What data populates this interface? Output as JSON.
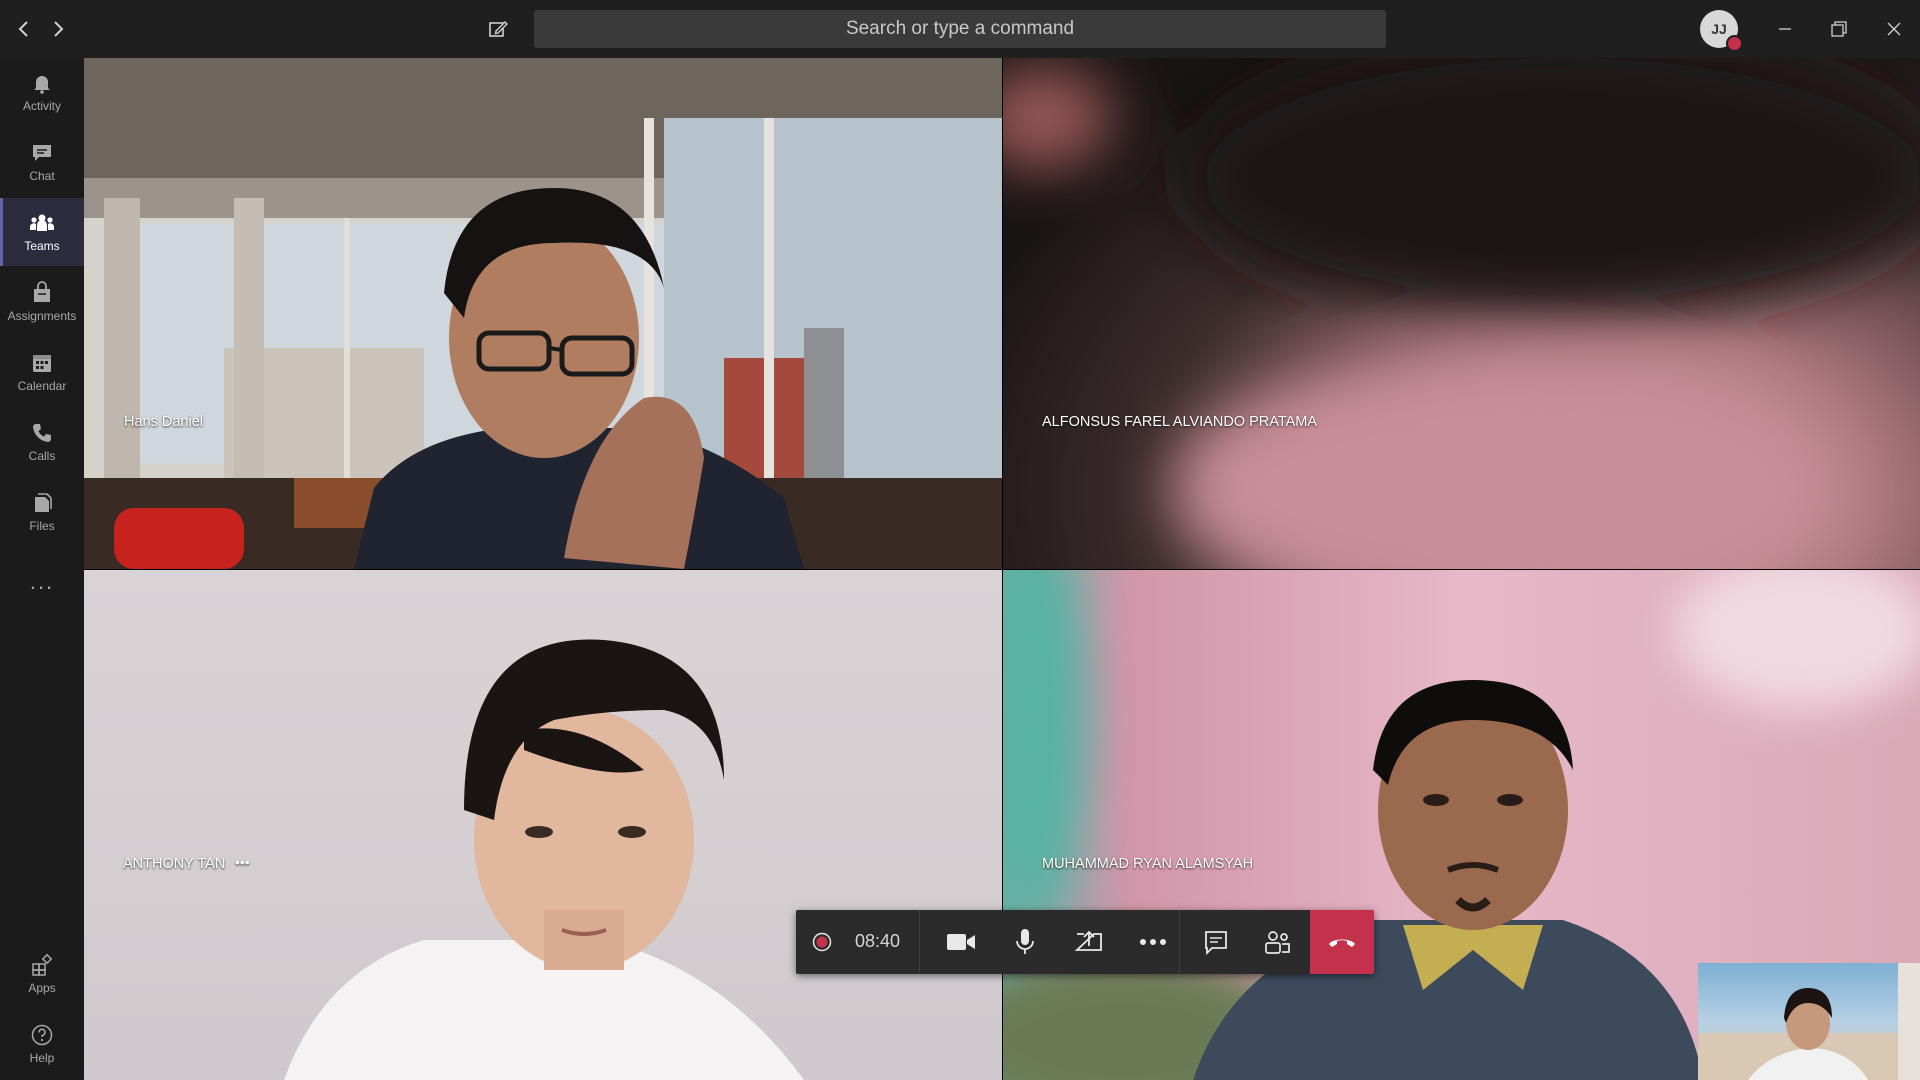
{
  "titlebar": {
    "search_placeholder": "Search or type a command",
    "avatar_initials": "JJ",
    "presence_color": "#c4314b"
  },
  "rail": {
    "items": [
      {
        "label": "Activity",
        "icon": "bell-icon"
      },
      {
        "label": "Chat",
        "icon": "chat-icon"
      },
      {
        "label": "Teams",
        "icon": "teams-icon",
        "active": true
      },
      {
        "label": "Assignments",
        "icon": "assignments-icon"
      },
      {
        "label": "Calendar",
        "icon": "calendar-icon"
      },
      {
        "label": "Calls",
        "icon": "phone-icon"
      },
      {
        "label": "Files",
        "icon": "files-icon"
      },
      {
        "label": "...",
        "icon": "more-icon"
      }
    ],
    "bottom": [
      {
        "label": "Apps",
        "icon": "apps-icon"
      },
      {
        "label": "Help",
        "icon": "help-icon"
      }
    ],
    "accent": "#6264a7"
  },
  "participants": [
    {
      "name": "Hans Daniel"
    },
    {
      "name": "ALFONSUS FAREL ALVIANDO PRATAMA"
    },
    {
      "name": "ANTHONY TAN",
      "more": "•••"
    },
    {
      "name": "MUHAMMAD RYAN ALAMSYAH"
    }
  ],
  "call_controls": {
    "timer": "08:40",
    "recording_icon": "record-icon",
    "buttons": [
      "camera-icon",
      "microphone-icon",
      "share-screen-icon",
      "more-icon",
      "chat-icon",
      "participants-icon"
    ],
    "hangup_color": "#c4314b"
  }
}
